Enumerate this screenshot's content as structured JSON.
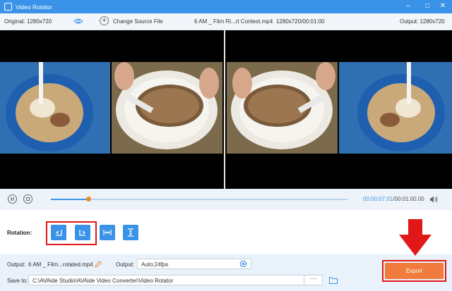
{
  "window": {
    "title": "Video Rotator"
  },
  "infobar": {
    "original": "Original: 1280x720",
    "change_source": "Change Source File",
    "file_info": "6 AM _ Film Ri...rt Contest.mp4",
    "file_meta": "1280x720/00:01:00",
    "output": "Output: 1280x720"
  },
  "playback": {
    "current_time": "00:00:07.01",
    "total_time": "/00:01:00.00",
    "progress": 0.125
  },
  "rotation": {
    "label": "Rotation:"
  },
  "output_settings": {
    "output_label": "Output:",
    "output_file": "6 AM _ Film...rotated.mp4",
    "format_label": "Output:",
    "format_value": "Auto;24fps",
    "save_label": "Save to:",
    "save_path": "C:\\AVAide Studio\\AVAide Video Converter\\Video Rotator",
    "dots": "···",
    "export_label": "Export"
  },
  "colors": {
    "accent": "#3a93e8",
    "export": "#f07b3c",
    "highlight": "#e01818"
  }
}
